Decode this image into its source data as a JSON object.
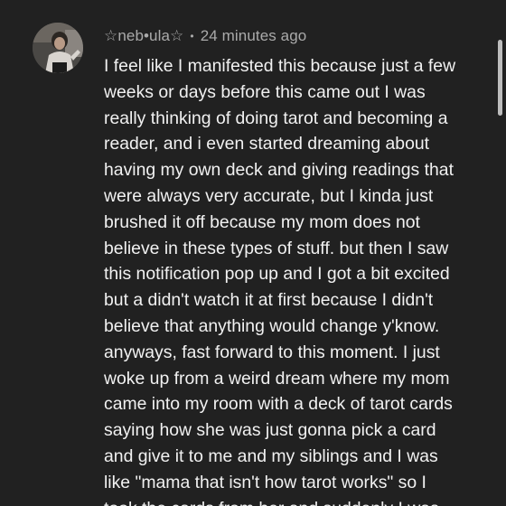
{
  "comment": {
    "author": "☆neb•ula☆",
    "separator": "•",
    "timestamp": "24 minutes ago",
    "lines": [
      "I feel like I manifested this because just a few",
      "weeks or days before this came out I was",
      "really thinking of doing tarot and becoming a",
      "reader, and i even started dreaming about",
      "having my own deck and giving readings that",
      "were always very accurate, but I kinda just",
      "brushed it off because my mom does not",
      "believe in these types of stuff. but then I saw",
      "this notification pop up and I got a bit excited",
      "but a didn't watch it at first because I didn't",
      "believe that anything would change y'know.",
      "anyways, fast forward to this moment. I just",
      "woke up from a weird dream where my mom",
      "came into my room with a deck of tarot cards",
      "saying how she was just gonna pick a card",
      "and give it to me and my siblings and I was",
      "like \"mama that isn't how tarot works\" so I",
      "took the cards from her and suddenly I was"
    ]
  },
  "icons": {
    "avatar": "user-photo-avatar"
  },
  "colors": {
    "background": "#212121",
    "text_primary": "#f1f1f1",
    "text_secondary": "#aaaaaa",
    "scrollbar": "#bdbdbd"
  }
}
